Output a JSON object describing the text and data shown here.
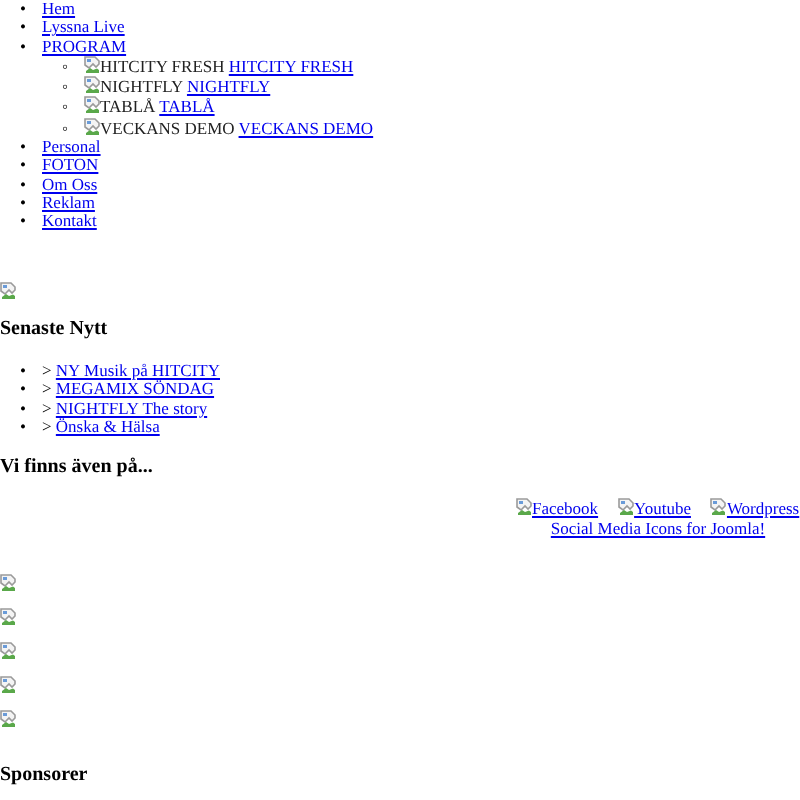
{
  "nav": [
    {
      "bullet": "•",
      "label": "Hem"
    },
    {
      "bullet": "•",
      "label": "Lyssna Live"
    },
    {
      "bullet": "•",
      "label": "PROGRAM",
      "children": [
        {
          "bullet": "◦",
          "image_alt": "HITCITY FRESH",
          "label": "HITCITY FRESH"
        },
        {
          "bullet": "◦",
          "image_alt": "NIGHTFLY",
          "label": "NIGHTFLY"
        },
        {
          "bullet": "◦",
          "image_alt": "TABLÅ",
          "label": "TABLÅ"
        },
        {
          "bullet": "◦",
          "image_alt": "VECKANS DEMO",
          "label": "VECKANS DEMO"
        }
      ]
    },
    {
      "bullet": "•",
      "label": "Personal"
    },
    {
      "bullet": "•",
      "label": "FOTON"
    },
    {
      "bullet": "•",
      "label": "Om Oss"
    },
    {
      "bullet": "•",
      "label": "Reklam"
    },
    {
      "bullet": "•",
      "label": "Kontakt"
    }
  ],
  "news": {
    "title": "Senaste Nytt",
    "items": [
      {
        "bullet": "•",
        "prefix": ">",
        "label": "NY Musik på HITCITY"
      },
      {
        "bullet": "•",
        "prefix": ">",
        "label": "MEGAMIX SÖNDAG"
      },
      {
        "bullet": "•",
        "prefix": ">",
        "label": "NIGHTFLY The story"
      },
      {
        "bullet": "•",
        "prefix": ">",
        "label": "Önska & Hälsa"
      }
    ]
  },
  "social": {
    "title": "Vi finns även på...",
    "links": [
      {
        "label": "Facebook"
      },
      {
        "label": "Youtube"
      },
      {
        "label": "Wordpress"
      }
    ],
    "credit": "Social Media Icons for Joomla!"
  },
  "sponsors": {
    "title": "Sponsorer"
  }
}
